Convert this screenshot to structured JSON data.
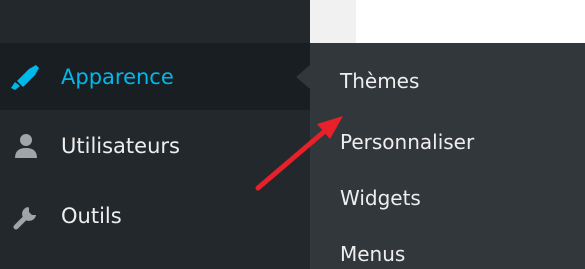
{
  "sidebar": {
    "items": [
      {
        "label": "Apparence",
        "icon": "paintbrush-icon",
        "active": true
      },
      {
        "label": "Utilisateurs",
        "icon": "user-icon",
        "active": false
      },
      {
        "label": "Outils",
        "icon": "wrench-icon",
        "active": false
      }
    ]
  },
  "submenu": {
    "items": [
      {
        "label": "Thèmes"
      },
      {
        "label": "Personnaliser"
      },
      {
        "label": "Widgets"
      },
      {
        "label": "Menus"
      }
    ]
  },
  "colors": {
    "sidebar_bg": "#23282d",
    "active_bg": "#191e23",
    "accent": "#00b9eb",
    "submenu_bg": "#32373c",
    "annotation_arrow": "#e8202a"
  }
}
